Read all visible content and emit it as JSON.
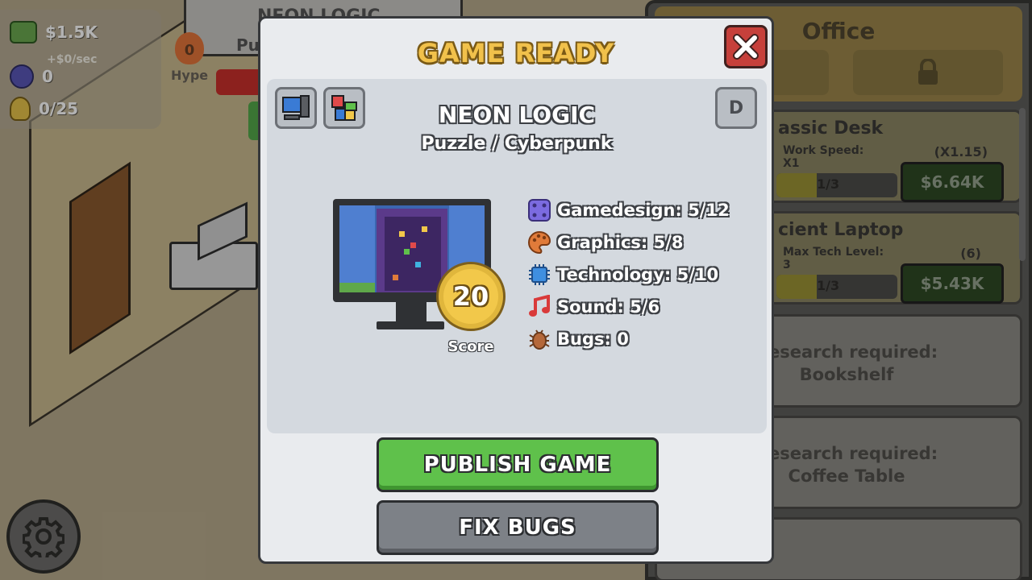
{
  "hud": {
    "money": "$1.5K",
    "income": "+$0/sec",
    "research_points": "0",
    "ideas": "0/25",
    "hype_value": "0",
    "hype_label": "Hype",
    "top_card_title": "NEON LOGIC",
    "top_card_sub": "Pu"
  },
  "office": {
    "title": "Office",
    "items": [
      {
        "title": "assic Desk",
        "sub1": "Work Speed:",
        "sub2": "X1",
        "progress_text": "1/3",
        "progress": 0.33,
        "mult": "(X1.15)",
        "price": "$6.64K"
      },
      {
        "title": "cient Laptop",
        "sub1": "Max Tech Level:",
        "sub2": "3",
        "progress_text": "1/3",
        "progress": 0.33,
        "mult": "(6)",
        "price": "$5.43K"
      }
    ],
    "locked": [
      {
        "line1": "Research required:",
        "line2": "Bookshelf"
      },
      {
        "line1": "Research required:",
        "line2": "Coffee Table"
      }
    ]
  },
  "modal": {
    "title": "GAME READY",
    "game_name": "NEON LOGIC",
    "genre": "Puzzle / Cyberpunk",
    "grade": "D",
    "score": "20",
    "score_label": "Score",
    "stats": [
      {
        "icon": "dice-icon",
        "text": "Gamedesign: 5/12",
        "color": "#7b6be0"
      },
      {
        "icon": "palette-icon",
        "text": "Graphics: 5/8",
        "color": "#e07b3a"
      },
      {
        "icon": "chip-icon",
        "text": "Technology: 5/10",
        "color": "#3f8fe0"
      },
      {
        "icon": "music-note-icon",
        "text": "Sound: 5/6",
        "color": "#d93a3a"
      },
      {
        "icon": "bug-icon",
        "text": "Bugs: 0",
        "color": "#b5683a"
      }
    ],
    "publish_label": "PUBLISH GAME",
    "fix_label": "FIX BUGS"
  }
}
